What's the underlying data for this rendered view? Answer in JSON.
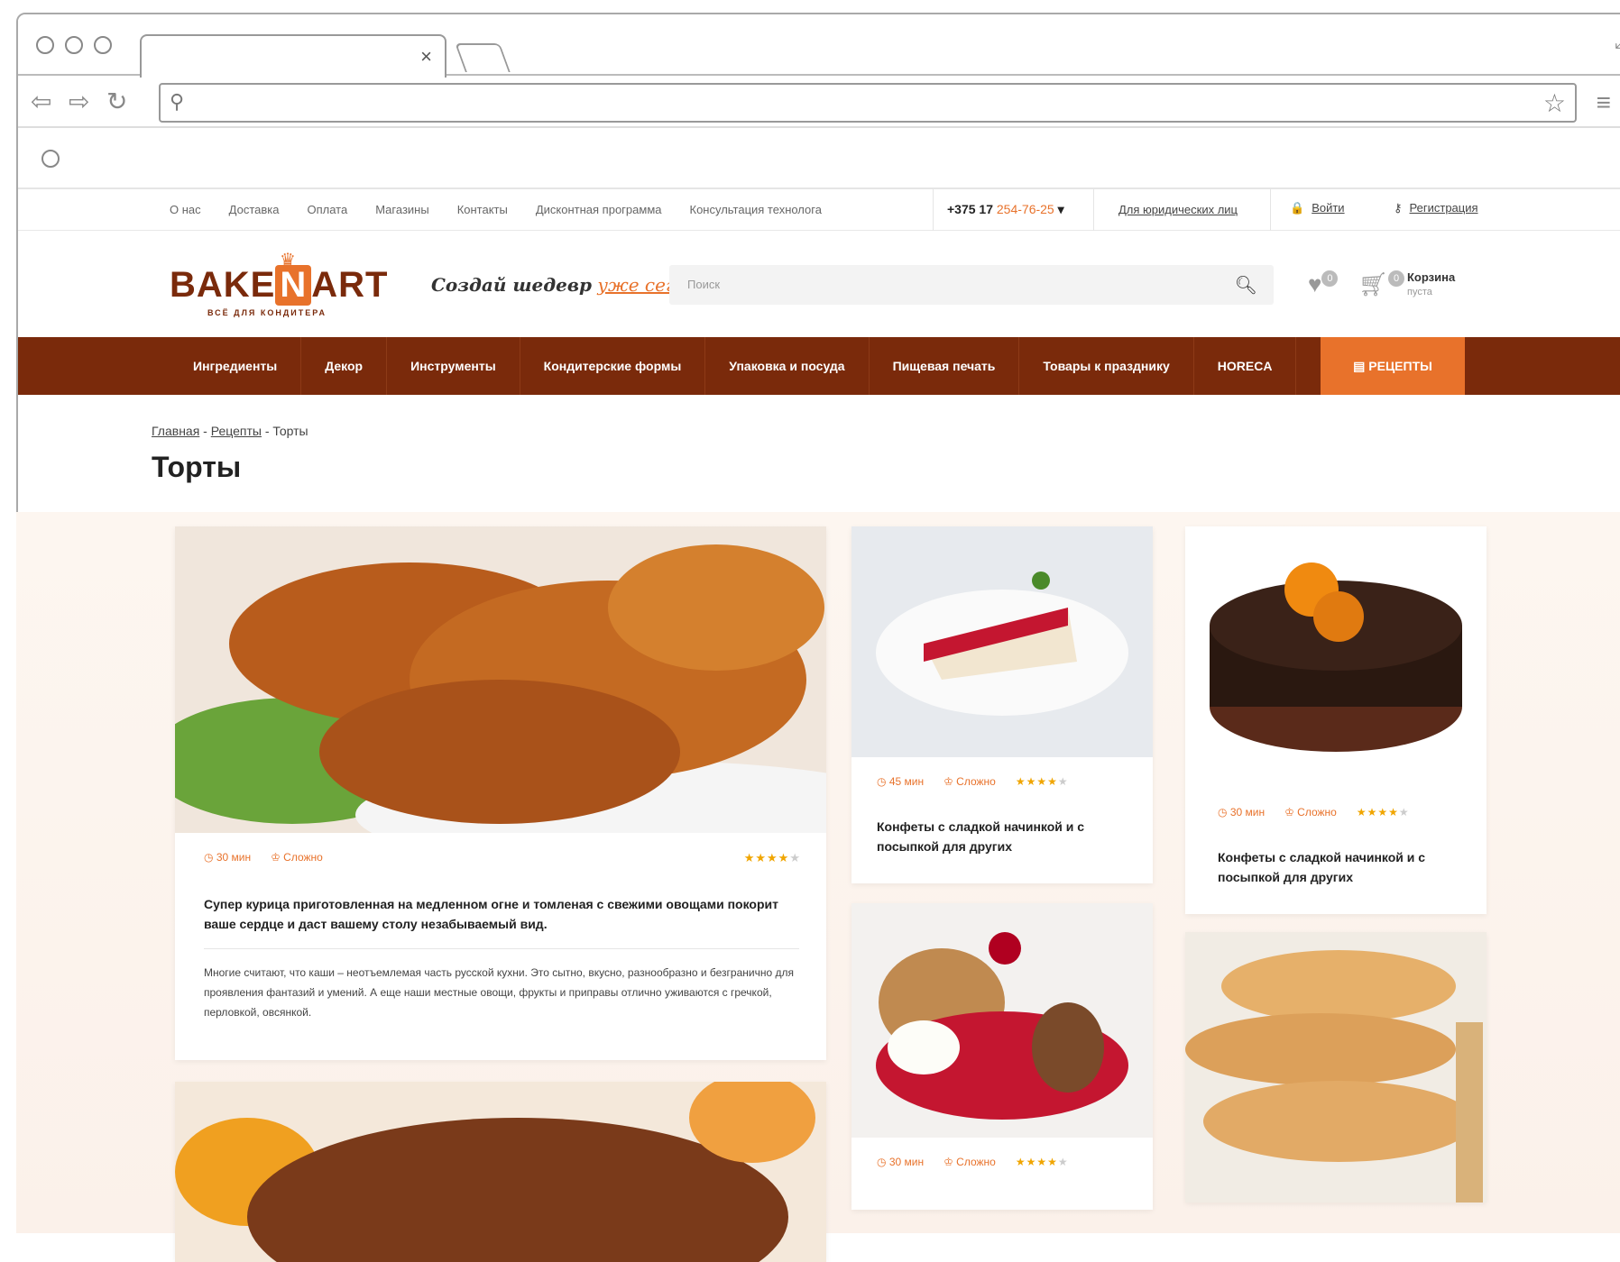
{
  "topbar": {
    "links": [
      "О нас",
      "Доставка",
      "Оплата",
      "Магазины",
      "Контакты",
      "Дисконтная программа",
      "Консультация технолога"
    ],
    "phone_prefix": "+375 17",
    "phone_number": "254-76-25",
    "legal_link": "Для юридических лиц",
    "login": "Войти",
    "register": "Регистрация"
  },
  "header": {
    "logo_word_left": "BAKE",
    "logo_letter": "N",
    "logo_word_right": "ART",
    "logo_tagline": "ВСЁ ДЛЯ КОНДИТЕРА",
    "slogan_main": "Создай шедевр",
    "slogan_accent": "уже сегодня",
    "search_placeholder": "Поиск",
    "fav_count": "0",
    "cart_count": "0",
    "cart_label": "Корзина",
    "cart_status": "пуста"
  },
  "nav": {
    "items": [
      "Ингредиенты",
      "Декор",
      "Инструменты",
      "Кондитерские формы",
      "Упаковка и посуда",
      "Пищевая печать",
      "Товары к празднику",
      "HORECA"
    ],
    "recipes": "РЕЦЕПТЫ"
  },
  "breadcrumb": {
    "home": "Главная",
    "recipes": "Рецепты",
    "current": "Торты"
  },
  "page_title": "Торты",
  "cards": [
    {
      "time": "30 мин",
      "difficulty": "Сложно",
      "rating": 4,
      "title": "Супер курица приготовленная на медленном огне и томленая с свежими овощами покорит ваше сердце и даст вашему столу незабываемый вид.",
      "desc": "Многие считают, что каши – неотъемлемая часть русской кухни. Это сытно, вкусно, разнообразно и безгранично для проявления фантазий и умений. А еще наши местные овощи, фрукты и приправы отлично уживаются с гречкой, перловкой, овсянкой."
    },
    {
      "time": "45 мин",
      "difficulty": "Сложно",
      "rating": 4,
      "title": "Конфеты с сладкой начинкой и с посыпкой для других"
    },
    {
      "time": "30 мин",
      "difficulty": "Сложно",
      "rating": 4,
      "title": "Конфеты с сладкой начинкой и с посыпкой для других"
    },
    {
      "time": "30 мин",
      "difficulty": "Сложно",
      "rating": 4
    }
  ],
  "colors": {
    "brand_brown": "#7a2a0b",
    "accent_orange": "#e8722b",
    "star": "#f0a500"
  }
}
